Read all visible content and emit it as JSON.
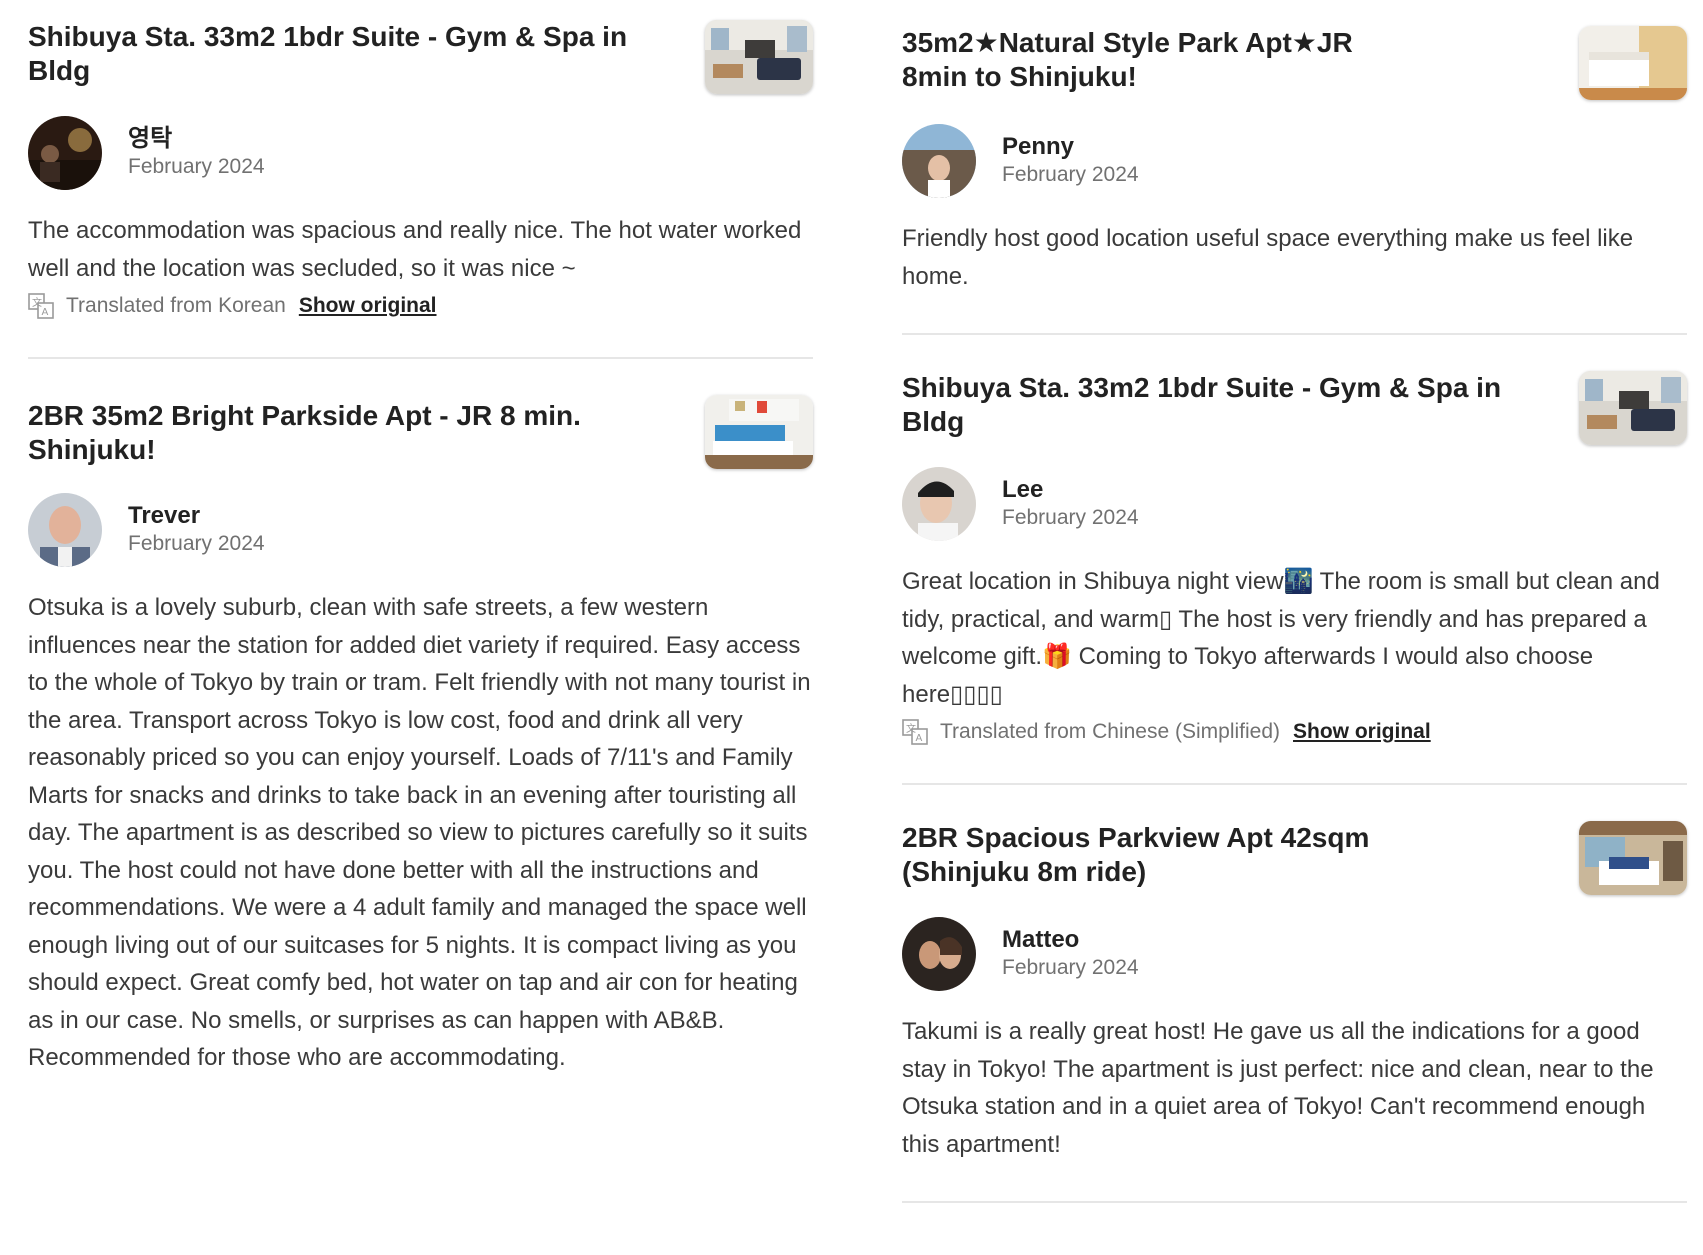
{
  "reviews_left": [
    {
      "listing_title": "Shibuya Sta. 33m2 1bdr Suite - Gym & Spa in Bldg",
      "reviewer_name": "영탁",
      "date": "February 2024",
      "text": "The accommodation was spacious and really nice. The hot water worked well and the location was secluded, so it was nice ~",
      "translated_note": "Translated from Korean",
      "show_original": "Show original"
    },
    {
      "listing_title": "2BR 35m2 Bright Parkside Apt - JR 8 min. Shinjuku!",
      "reviewer_name": "Trever",
      "date": "February 2024",
      "text": "Otsuka is a lovely suburb, clean with safe streets, a few western influences near the station for added diet variety if required. Easy access to the whole of Tokyo by train or tram. Felt friendly with not many tourist in the area. Transport across Tokyo is low cost, food and drink all very reasonably priced so you can enjoy yourself. Loads of 7/11's and Family Marts for snacks and drinks to take back in an evening after touristing all day. The apartment is as described so view to pictures carefully so it suits you. The host could not have done better with all the instructions and recommendations. We were a 4 adult family and managed the space well enough living out of our suitcases for 5 nights. It is compact living as you should expect. Great comfy bed, hot water on tap and air con for heating as in our case. No smells, or surprises as can happen with AB&B. Recommended for those who are accommodating."
    }
  ],
  "reviews_right": [
    {
      "listing_title": "35m2★Natural Style Park Apt★JR 8min to Shinjuku!",
      "reviewer_name": "Penny",
      "date": "February 2024",
      "text": "Friendly host good location useful space everything make us feel like home."
    },
    {
      "listing_title": "Shibuya Sta. 33m2 1bdr Suite - Gym & Spa in Bldg",
      "reviewer_name": "Lee",
      "date": "February 2024",
      "text": "Great location in Shibuya night view🌃 The room is small but clean and tidy, practical, and warm▯ The host is very friendly and has prepared a welcome gift.🎁 Coming to Tokyo afterwards I would also choose here▯▯▯▯",
      "translated_note": "Translated from Chinese (Simplified)",
      "show_original": "Show original"
    },
    {
      "listing_title": "2BR Spacious Parkview Apt 42sqm (Shinjuku 8m ride)",
      "reviewer_name": "Matteo",
      "date": "February 2024",
      "text": "Takumi is a really great host! He gave us all the indications for a good stay in Tokyo! The apartment is just perfect: nice and clean, near to the Otsuka station and in a quiet area of Tokyo! Can't recommend enough this apartment!"
    }
  ],
  "icons": {
    "translate": "translate-icon"
  }
}
